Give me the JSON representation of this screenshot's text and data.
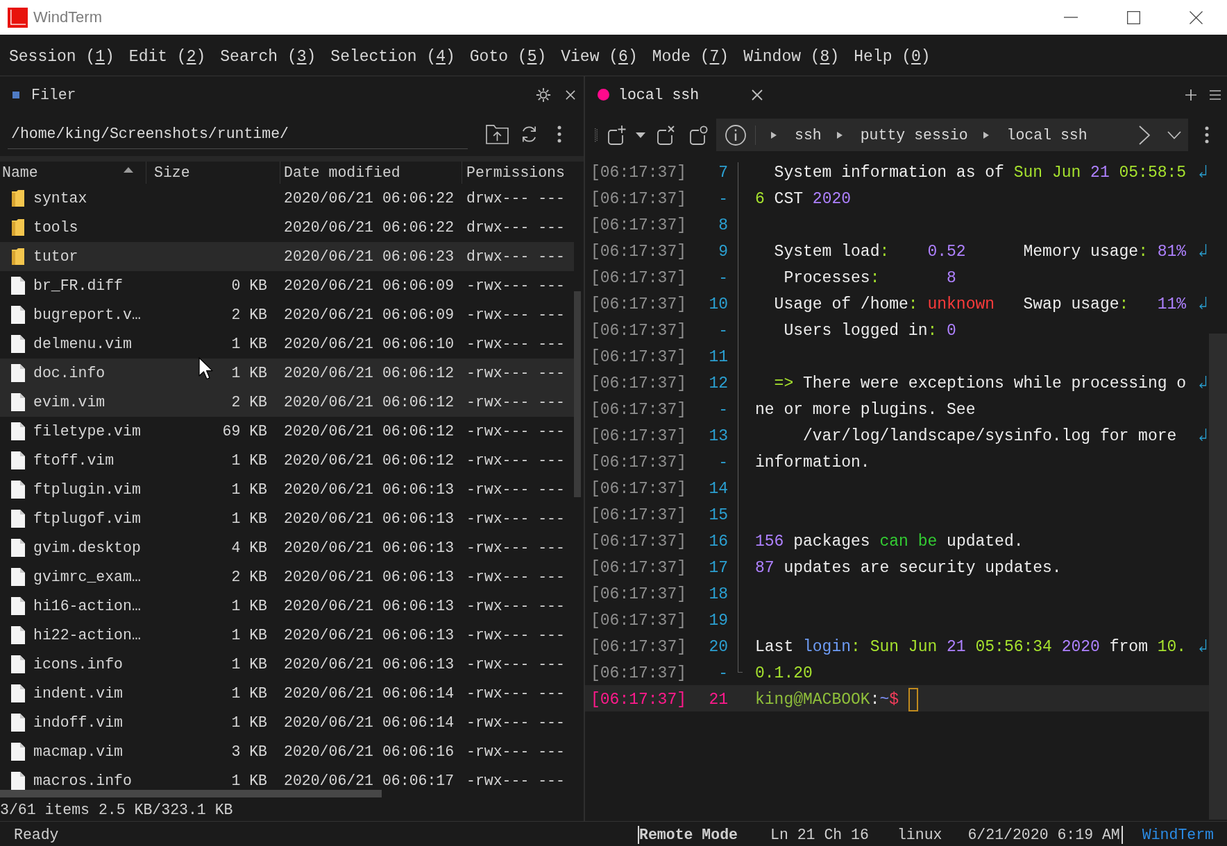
{
  "window": {
    "title": "WindTerm"
  },
  "menu": [
    {
      "before": "Session (",
      "key": "1",
      "after": ")"
    },
    {
      "before": "Edit (",
      "key": "2",
      "after": ")"
    },
    {
      "before": "Search (",
      "key": "3",
      "after": ")"
    },
    {
      "before": "Selection (",
      "key": "4",
      "after": ")"
    },
    {
      "before": "Goto (",
      "key": "5",
      "after": ")"
    },
    {
      "before": "View (",
      "key": "6",
      "after": ")"
    },
    {
      "before": "Mode (",
      "key": "7",
      "after": ")"
    },
    {
      "before": "Window (",
      "key": "8",
      "after": ")"
    },
    {
      "before": "Help (",
      "key": "0",
      "after": ")"
    }
  ],
  "filer": {
    "title": "Filer",
    "path": "/home/king/Screenshots/runtime/",
    "columns": [
      {
        "label": "Name",
        "sorted": true
      },
      {
        "label": "Size",
        "sorted": false
      },
      {
        "label": "Date modified",
        "sorted": false
      },
      {
        "label": "Permissions",
        "sorted": false
      }
    ],
    "rows": [
      {
        "kind": "folder",
        "name": "syntax",
        "date": "2020/06/21 06:06:22",
        "permissions": "drwx--- ---",
        "selected": false
      },
      {
        "kind": "folder",
        "name": "tools",
        "date": "2020/06/21 06:06:22",
        "permissions": "drwx--- ---",
        "selected": false
      },
      {
        "kind": "folder",
        "name": "tutor",
        "date": "2020/06/21 06:06:23",
        "permissions": "drwx--- ---",
        "selected": true
      },
      {
        "kind": "file",
        "name": "br_FR.diff",
        "size": "0 KB",
        "date": "2020/06/21 06:06:09",
        "permissions": "-rwx--- ---",
        "selected": false
      },
      {
        "kind": "file",
        "name": "bugreport.v…",
        "size": "2 KB",
        "date": "2020/06/21 06:06:09",
        "permissions": "-rwx--- ---",
        "selected": false
      },
      {
        "kind": "file",
        "name": "delmenu.vim",
        "size": "1 KB",
        "date": "2020/06/21 06:06:10",
        "permissions": "-rwx--- ---",
        "selected": false
      },
      {
        "kind": "file",
        "name": "doc.info",
        "size": "1 KB",
        "date": "2020/06/21 06:06:12",
        "permissions": "-rwx--- ---",
        "selected": true
      },
      {
        "kind": "file",
        "name": "evim.vim",
        "size": "2 KB",
        "date": "2020/06/21 06:06:12",
        "permissions": "-rwx--- ---",
        "selected": true
      },
      {
        "kind": "file",
        "name": "filetype.vim",
        "size": "69 KB",
        "date": "2020/06/21 06:06:12",
        "permissions": "-rwx--- ---",
        "selected": false
      },
      {
        "kind": "file",
        "name": "ftoff.vim",
        "size": "1 KB",
        "date": "2020/06/21 06:06:12",
        "permissions": "-rwx--- ---",
        "selected": false
      },
      {
        "kind": "file",
        "name": "ftplugin.vim",
        "size": "1 KB",
        "date": "2020/06/21 06:06:13",
        "permissions": "-rwx--- ---",
        "selected": false
      },
      {
        "kind": "file",
        "name": "ftplugof.vim",
        "size": "1 KB",
        "date": "2020/06/21 06:06:13",
        "permissions": "-rwx--- ---",
        "selected": false
      },
      {
        "kind": "file",
        "name": "gvim.desktop",
        "size": "4 KB",
        "date": "2020/06/21 06:06:13",
        "permissions": "-rwx--- ---",
        "selected": false
      },
      {
        "kind": "file",
        "name": "gvimrc_exam…",
        "size": "2 KB",
        "date": "2020/06/21 06:06:13",
        "permissions": "-rwx--- ---",
        "selected": false
      },
      {
        "kind": "file",
        "name": "hi16-action…",
        "size": "1 KB",
        "date": "2020/06/21 06:06:13",
        "permissions": "-rwx--- ---",
        "selected": false
      },
      {
        "kind": "file",
        "name": "hi22-action…",
        "size": "1 KB",
        "date": "2020/06/21 06:06:13",
        "permissions": "-rwx--- ---",
        "selected": false
      },
      {
        "kind": "file",
        "name": "icons.info",
        "size": "1 KB",
        "date": "2020/06/21 06:06:13",
        "permissions": "-rwx--- ---",
        "selected": false
      },
      {
        "kind": "file",
        "name": "indent.vim",
        "size": "1 KB",
        "date": "2020/06/21 06:06:14",
        "permissions": "-rwx--- ---",
        "selected": false
      },
      {
        "kind": "file",
        "name": "indoff.vim",
        "size": "1 KB",
        "date": "2020/06/21 06:06:14",
        "permissions": "-rwx--- ---",
        "selected": false
      },
      {
        "kind": "file",
        "name": "macmap.vim",
        "size": "3 KB",
        "date": "2020/06/21 06:06:16",
        "permissions": "-rwx--- ---",
        "selected": false
      },
      {
        "kind": "file",
        "name": "macros.info",
        "size": "1 KB",
        "date": "2020/06/21 06:06:17",
        "permissions": "-rwx--- ---",
        "selected": false
      }
    ],
    "summary": "3/61 items 2.5 KB/323.1 KB"
  },
  "terminal": {
    "tabs": [
      {
        "label": "local ssh",
        "color": "#ff0a8c",
        "selected": true
      }
    ],
    "breadcrumb": [
      "ssh",
      "putty sessio",
      "local ssh"
    ],
    "lines": [
      {
        "time": "[06:17:37]",
        "number": "7",
        "wrapped": true,
        "segments": [
          {
            "text": "  System information as of ",
            "color": "#ececec"
          },
          {
            "text": "Sun Jun ",
            "color": "#a6e22e"
          },
          {
            "text": "21",
            "color": "#ae81ff"
          },
          {
            "text": " 05:58:5",
            "color": "#a6e22e"
          }
        ]
      },
      {
        "time": "[06:17:37]",
        "number": "-",
        "wrapped": false,
        "segments": [
          {
            "text": "6",
            "color": "#a6e22e"
          },
          {
            "text": " CST ",
            "color": "#ececec"
          },
          {
            "text": "2020",
            "color": "#ae81ff"
          }
        ]
      },
      {
        "time": "[06:17:37]",
        "number": "8",
        "wrapped": false
      },
      {
        "time": "[06:17:37]",
        "number": "9",
        "wrapped": true,
        "segments": [
          {
            "text": "  System load",
            "color": "#ececec"
          },
          {
            "text": ":",
            "color": "#a6e22e"
          },
          {
            "text": "    0.52",
            "color": "#ae81ff"
          },
          {
            "text": "      Memory usage",
            "color": "#ececec"
          },
          {
            "text": ":",
            "color": "#a6e22e"
          },
          {
            "text": " 81%",
            "color": "#ae81ff"
          }
        ]
      },
      {
        "time": "[06:17:37]",
        "number": "-",
        "wrapped": false,
        "segments": [
          {
            "text": "   Processes",
            "color": "#ececec"
          },
          {
            "text": ":",
            "color": "#a6e22e"
          },
          {
            "text": "       8",
            "color": "#ae81ff"
          }
        ]
      },
      {
        "time": "[06:17:37]",
        "number": "10",
        "wrapped": true,
        "segments": [
          {
            "text": "  Usage of /home",
            "color": "#ececec"
          },
          {
            "text": ":",
            "color": "#a6e22e"
          },
          {
            "text": " unknown",
            "color": "#ff3b3b"
          },
          {
            "text": "   Swap usage",
            "color": "#ececec"
          },
          {
            "text": ":",
            "color": "#a6e22e"
          },
          {
            "text": "   11%",
            "color": "#ae81ff"
          }
        ]
      },
      {
        "time": "[06:17:37]",
        "number": "-",
        "wrapped": false,
        "segments": [
          {
            "text": "   Users logged in",
            "color": "#ececec"
          },
          {
            "text": ":",
            "color": "#a6e22e"
          },
          {
            "text": " 0",
            "color": "#ae81ff"
          }
        ]
      },
      {
        "time": "[06:17:37]",
        "number": "11",
        "wrapped": false
      },
      {
        "time": "[06:17:37]",
        "number": "12",
        "wrapped": true,
        "segments": [
          {
            "text": "  =>",
            "color": "#a6e22e"
          },
          {
            "text": " There were exceptions while processing o",
            "color": "#ececec"
          }
        ]
      },
      {
        "time": "[06:17:37]",
        "number": "-",
        "wrapped": false,
        "segments": [
          {
            "text": "ne or more plugins. See",
            "color": "#ececec"
          }
        ]
      },
      {
        "time": "[06:17:37]",
        "number": "13",
        "wrapped": true,
        "segments": [
          {
            "text": "     /var/log/landscape/sysinfo.log for more ",
            "color": "#ececec"
          }
        ]
      },
      {
        "time": "[06:17:37]",
        "number": "-",
        "wrapped": false,
        "segments": [
          {
            "text": "information.",
            "color": "#ececec"
          }
        ]
      },
      {
        "time": "[06:17:37]",
        "number": "14",
        "wrapped": false
      },
      {
        "time": "[06:17:37]",
        "number": "15",
        "wrapped": false
      },
      {
        "time": "[06:17:37]",
        "number": "16",
        "wrapped": false,
        "segments": [
          {
            "text": "156",
            "color": "#ae81ff"
          },
          {
            "text": " packages ",
            "color": "#ececec"
          },
          {
            "text": "can be",
            "color": "#33cc33"
          },
          {
            "text": " updated.",
            "color": "#ececec"
          }
        ]
      },
      {
        "time": "[06:17:37]",
        "number": "17",
        "wrapped": false,
        "segments": [
          {
            "text": "87",
            "color": "#ae81ff"
          },
          {
            "text": " updates are security updates.",
            "color": "#ececec"
          }
        ]
      },
      {
        "time": "[06:17:37]",
        "number": "18",
        "wrapped": false
      },
      {
        "time": "[06:17:37]",
        "number": "19",
        "wrapped": false
      },
      {
        "time": "[06:17:37]",
        "number": "20",
        "wrapped": true,
        "segments": [
          {
            "text": "Last ",
            "color": "#ececec"
          },
          {
            "text": "login",
            "color": "#6e9cf5"
          },
          {
            "text": ": Sun Jun ",
            "color": "#a6e22e"
          },
          {
            "text": "21",
            "color": "#ae81ff"
          },
          {
            "text": " 05:56:34 ",
            "color": "#a6e22e"
          },
          {
            "text": "2020",
            "color": "#ae81ff"
          },
          {
            "text": " from ",
            "color": "#ececec"
          },
          {
            "text": "10.",
            "color": "#a6e22e"
          }
        ]
      },
      {
        "time": "[06:17:37]",
        "number": "-",
        "wrapped": false,
        "segments": [
          {
            "text": "0.1.20",
            "color": "#a6e22e"
          }
        ]
      }
    ],
    "prompt": {
      "time": "[06:17:37]",
      "number": "21",
      "segments": [
        {
          "text": "king@MACBOOK",
          "color": "#8fbf3a"
        },
        {
          "text": ":",
          "color": "#ececec"
        },
        {
          "text": "~",
          "color": "#7b8cf0"
        },
        {
          "text": "$",
          "color": "#f03c5a"
        }
      ]
    }
  },
  "status_bar": {
    "message": "Ready",
    "mode": "Remote Mode",
    "position": "Ln 21 Ch 16",
    "system": "linux",
    "datetime": "6/21/2020 6:19 AM",
    "app": "WindTerm"
  }
}
